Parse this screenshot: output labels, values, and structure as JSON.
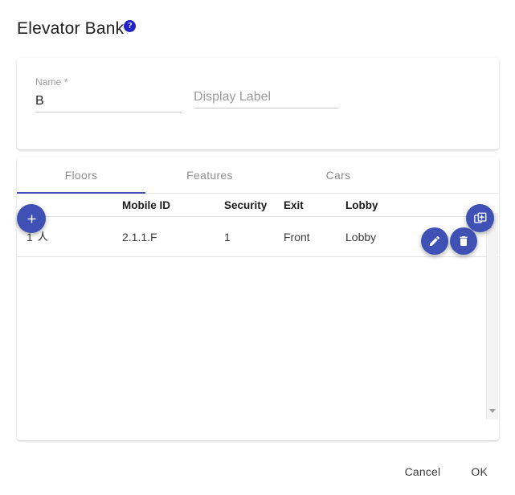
{
  "header": {
    "title": "Elevator Bank",
    "help_icon": "help-circle-icon",
    "help_glyph": "?"
  },
  "form": {
    "name_field": {
      "label": "Name *",
      "value": "B",
      "placeholder": ""
    },
    "display_field": {
      "label": "",
      "value": "",
      "placeholder": "Display Label"
    }
  },
  "tabs": [
    {
      "label": "Floors",
      "active": true
    },
    {
      "label": "Features",
      "active": false
    },
    {
      "label": "Cars",
      "active": false
    }
  ],
  "table": {
    "columns": [
      "",
      "Mobile ID",
      "Security",
      "Exit",
      "Lobby",
      ""
    ],
    "rows": [
      {
        "index": "1",
        "index_glyph": "人",
        "mobile_id": "2.1.1.F",
        "security": "1",
        "exit": "Front",
        "lobby": "Lobby"
      }
    ]
  },
  "actions": {
    "add": {
      "name": "add-icon",
      "tooltip": ""
    },
    "copy": {
      "name": "copy-add-icon",
      "tooltip": ""
    },
    "edit": {
      "name": "edit-pencil-icon",
      "tooltip": ""
    },
    "delete": {
      "name": "delete-trash-icon",
      "tooltip": ""
    }
  },
  "footer": {
    "cancel_label": "Cancel",
    "ok_label": "OK"
  },
  "colors": {
    "accent": "#3f51b5",
    "help_badge": "#2222c8",
    "text_primary": "#212121",
    "text_muted": "#9a9a9a",
    "divider": "#e0e0e0"
  }
}
